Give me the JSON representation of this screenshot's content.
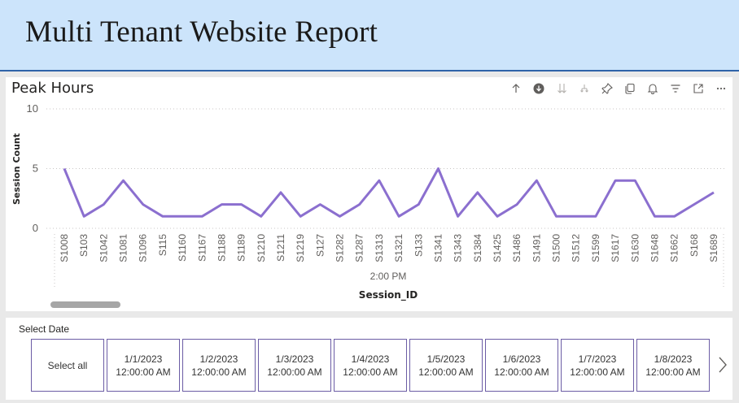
{
  "header": {
    "title": "Multi Tenant Website Report",
    "bg_color": "#cce4fb",
    "border_color": "#2f63a8"
  },
  "visual": {
    "title": "Peak Hours",
    "toolbar": [
      {
        "name": "drill-up-icon"
      },
      {
        "name": "drill-down-on-icon"
      },
      {
        "name": "go-to-next-level-icon"
      },
      {
        "name": "expand-hierarchy-icon"
      },
      {
        "name": "pin-icon"
      },
      {
        "name": "copy-visual-icon"
      },
      {
        "name": "alert-bell-icon"
      },
      {
        "name": "filter-icon"
      },
      {
        "name": "focus-mode-icon"
      },
      {
        "name": "more-options-icon"
      }
    ]
  },
  "chart_data": {
    "type": "line",
    "xlabel": "Session_ID",
    "ylabel": "Session Count",
    "group_label": "2:00 PM",
    "ylim": [
      0,
      10
    ],
    "yticks": [
      0,
      5,
      10
    ],
    "grid": "horizontal dotted",
    "line_color": "#8b6fcf",
    "categories": [
      "S1008",
      "S103",
      "S1042",
      "S1081",
      "S1096",
      "S115",
      "S1160",
      "S1167",
      "S1188",
      "S1189",
      "S1210",
      "S1211",
      "S1219",
      "S127",
      "S1282",
      "S1287",
      "S1313",
      "S1321",
      "S133",
      "S1341",
      "S1343",
      "S1384",
      "S1425",
      "S1486",
      "S1491",
      "S1500",
      "S1512",
      "S1599",
      "S1617",
      "S1630",
      "S1648",
      "S1662",
      "S168",
      "S1689"
    ],
    "series": [
      {
        "values": [
          5,
          1,
          2,
          4,
          2,
          1,
          1,
          1,
          2,
          2,
          1,
          3,
          1,
          2,
          1,
          2,
          4,
          1,
          2,
          5,
          1,
          3,
          1,
          2,
          4,
          1,
          1,
          1,
          4,
          4,
          1,
          1,
          2,
          3
        ]
      }
    ]
  },
  "slicer": {
    "header": "Select Date",
    "select_all": "Select all",
    "tiles": [
      {
        "date": "1/1/2023",
        "time": "12:00:00 AM"
      },
      {
        "date": "1/2/2023",
        "time": "12:00:00 AM"
      },
      {
        "date": "1/3/2023",
        "time": "12:00:00 AM"
      },
      {
        "date": "1/4/2023",
        "time": "12:00:00 AM"
      },
      {
        "date": "1/5/2023",
        "time": "12:00:00 AM"
      },
      {
        "date": "1/6/2023",
        "time": "12:00:00 AM"
      },
      {
        "date": "1/7/2023",
        "time": "12:00:00 AM"
      },
      {
        "date": "1/8/2023",
        "time": "12:00:00 AM"
      }
    ],
    "next_icon": "chevron-right-icon",
    "tile_border_color": "#6b5ca5"
  }
}
